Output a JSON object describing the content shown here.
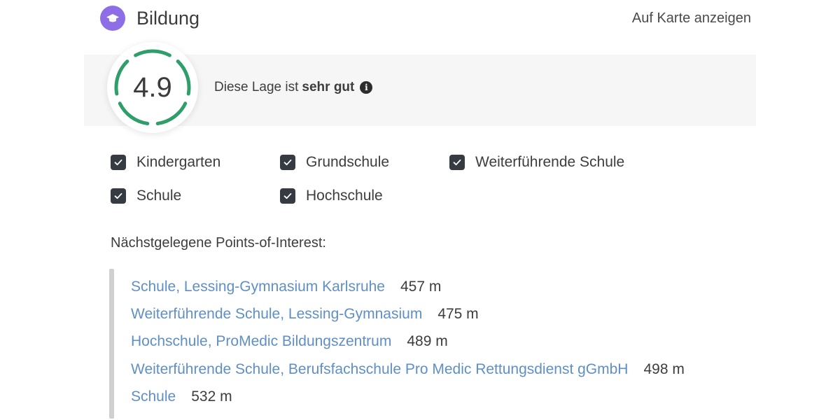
{
  "header": {
    "title": "Bildung",
    "icon": "graduation-cap-icon",
    "icon_color": "#8e6ee6",
    "map_link": "Auf Karte anzeigen"
  },
  "rating": {
    "score": "4.9",
    "score_fraction": 0.98,
    "text_prefix": "Diese Lage ist",
    "text_strong": "sehr gut",
    "info_icon": "info-icon",
    "ring_color": "#2f9e6a"
  },
  "filters": [
    {
      "label": "Kindergarten",
      "checked": true
    },
    {
      "label": "Grundschule",
      "checked": true
    },
    {
      "label": "Weiterführende Schule",
      "checked": true
    },
    {
      "label": "Schule",
      "checked": true
    },
    {
      "label": "Hochschule",
      "checked": true
    }
  ],
  "poi": {
    "heading": "Nächstgelegene Points-of-Interest:",
    "items": [
      {
        "name": "Schule, Lessing-Gymnasium Karlsruhe",
        "distance": "457 m"
      },
      {
        "name": "Weiterführende Schule, Lessing-Gymnasium",
        "distance": "475 m"
      },
      {
        "name": "Hochschule, ProMedic Bildungszentrum",
        "distance": "489 m"
      },
      {
        "name": "Weiterführende Schule, Berufsfachschule Pro Medic Rettungsdienst gGmbH",
        "distance": "498 m"
      },
      {
        "name": "Schule",
        "distance": "532 m"
      }
    ],
    "link_color": "#5f8fc5"
  }
}
